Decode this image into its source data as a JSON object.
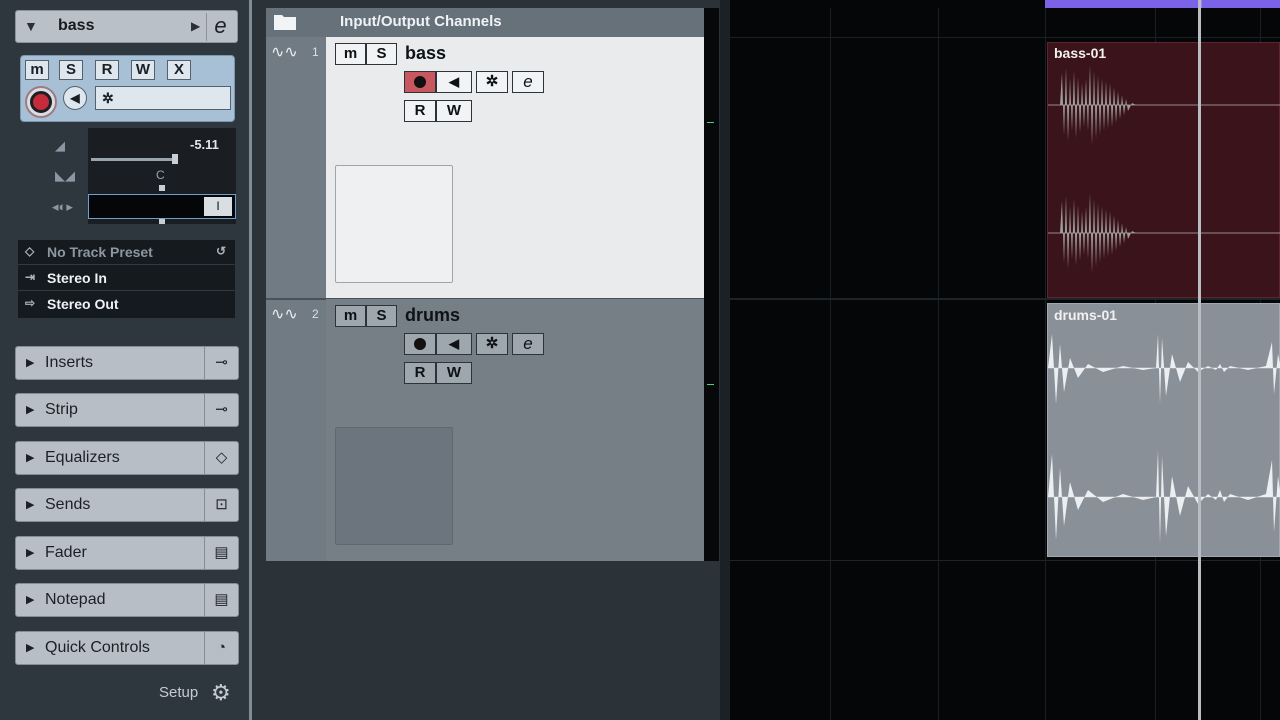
{
  "inspector": {
    "track_name": "bass",
    "buttons": {
      "mute": "m",
      "solo": "S",
      "read": "R",
      "write": "W",
      "x": "X"
    },
    "volume_value": "-5.11",
    "pan_value": "C",
    "preset": "No Track Preset",
    "input": "Stereo In",
    "output": "Stereo Out",
    "sections": [
      "Inserts",
      "Strip",
      "Equalizers",
      "Sends",
      "Fader",
      "Notepad",
      "Quick Controls"
    ],
    "setup": "Setup"
  },
  "tracklist": {
    "folder_title": "Input/Output Channels",
    "tracks": [
      {
        "number": "1",
        "name": "bass",
        "mute": "m",
        "solo": "S",
        "read": "R",
        "write": "W"
      },
      {
        "number": "2",
        "name": "drums",
        "mute": "m",
        "solo": "S",
        "read": "R",
        "write": "W"
      }
    ]
  },
  "arrange": {
    "clips": [
      {
        "name": "bass-01",
        "color": "#3b131b"
      },
      {
        "name": "drums-01",
        "color": "#8a9098"
      }
    ],
    "cycle_color": "#7b62e6"
  },
  "colors": {
    "record_red": "#c52b38",
    "selected_track_bg": "#e9ebed",
    "meter_green": "#4ad37c"
  }
}
